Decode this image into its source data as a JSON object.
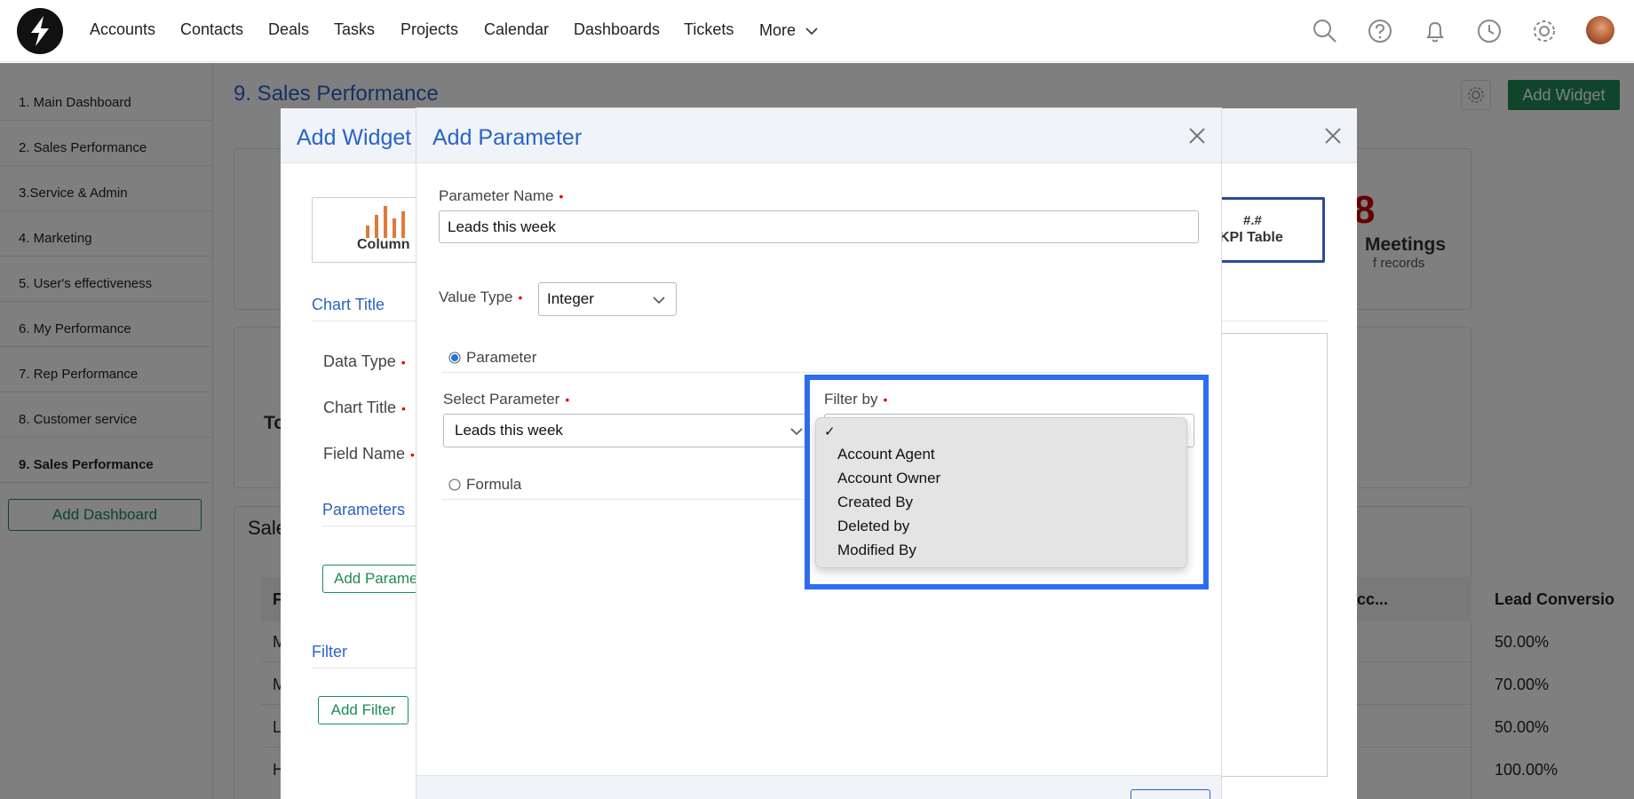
{
  "nav": {
    "items": [
      "Accounts",
      "Contacts",
      "Deals",
      "Tasks",
      "Projects",
      "Calendar",
      "Dashboards",
      "Tickets"
    ],
    "more_label": "More"
  },
  "sidebar": {
    "items": [
      {
        "label": "1. Main Dashboard",
        "active": false
      },
      {
        "label": "2. Sales Performance",
        "active": false
      },
      {
        "label": "3.Service & Admin",
        "active": false
      },
      {
        "label": "4. Marketing",
        "active": false
      },
      {
        "label": "5. User's effectiveness",
        "active": false
      },
      {
        "label": "6. My Performance",
        "active": false
      },
      {
        "label": "7. Rep Performance",
        "active": false
      },
      {
        "label": "8. Customer service",
        "active": false
      },
      {
        "label": "9. Sales Performance",
        "active": true
      }
    ],
    "add_dashboard_label": "Add Dashboard"
  },
  "page": {
    "title": "9. Sales Performance",
    "add_widget_label": "Add Widget",
    "kpi_number": "8",
    "kpi_label": "Meetings",
    "kpi_sub": "f records",
    "partial_to": "To",
    "partial_sale": "Sale",
    "table_header_partial_p": "F",
    "table_header_acc": "Acc...",
    "table_header_lead": "Lead Conversio",
    "row_letters": [
      "M",
      "M",
      "L",
      "H"
    ],
    "lead_values": [
      "50.00%",
      "70.00%",
      "50.00%",
      "100.00%"
    ]
  },
  "widget_modal": {
    "title": "Add Widget",
    "column_label": "Column",
    "kpi_symbol": "#.#",
    "kpi_table_label": "KPI Table",
    "chart_title_section": "Chart Title",
    "data_type_label": "Data Type",
    "chart_title_label": "Chart Title",
    "field_name_label": "Field Name",
    "parameters_section": "Parameters",
    "add_parameter_label": "Add Parame",
    "filter_section": "Filter",
    "add_filter_label": "Add Filter"
  },
  "param_modal": {
    "title": "Add Parameter",
    "parameter_name_label": "Parameter Name",
    "parameter_name_value": "Leads this week",
    "value_type_label": "Value Type",
    "value_type_value": "Integer",
    "parameter_radio_label": "Parameter",
    "select_parameter_label": "Select Parameter",
    "select_parameter_value": "Leads this week",
    "filter_by_label": "Filter by",
    "formula_radio_label": "Formula",
    "dropdown_check": "✓",
    "dropdown_options": [
      "Account Agent",
      "Account Owner",
      "Created By",
      "Deleted by",
      "Modified By"
    ]
  },
  "colors": {
    "accent_blue": "#2b63c6",
    "green": "#1e8b57",
    "highlight": "#2d6df0",
    "required": "#e00000"
  }
}
